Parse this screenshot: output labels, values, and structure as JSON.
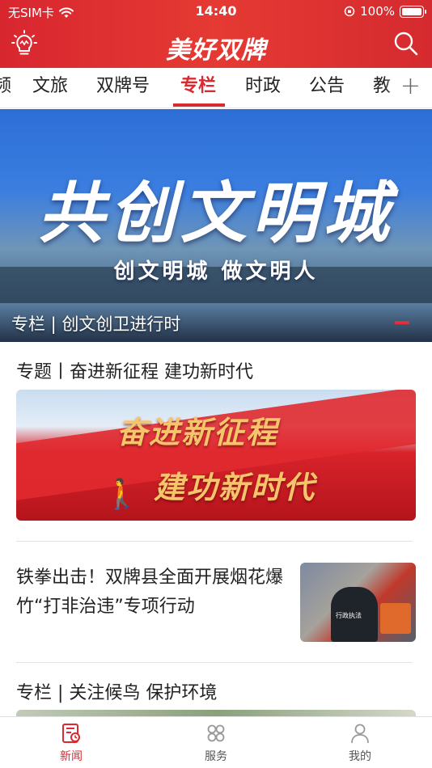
{
  "status_bar": {
    "carrier": "无SIM卡",
    "time": "14:40",
    "battery": "100%"
  },
  "header": {
    "title": "美好双牌",
    "left_icon": "lightbulb-icon",
    "right_icon": "search-icon"
  },
  "tabs": {
    "items": [
      "频",
      "文旅",
      "双牌号",
      "专栏",
      "时政",
      "公告",
      "教"
    ],
    "active": "专栏",
    "more_icon": "plus-icon"
  },
  "banner": {
    "title": "共创文明城",
    "subtitle": "创文明城 做文明人",
    "caption": "专栏 | 创文创卫进行时"
  },
  "feed": {
    "topic_section": {
      "title": "专题丨奋进新征程 建功新时代",
      "image_text_1": "奋进新征程",
      "image_text_2": "建功新时代"
    },
    "news_item": {
      "title": "铁拳出击！双牌县全面开展烟花爆竹“打非治违”专项行动",
      "thumb_label": "行政执法"
    },
    "column_section": {
      "title": "专栏 | 关注候鸟 保护环境"
    }
  },
  "bottom_nav": {
    "items": [
      {
        "label": "新闻",
        "icon": "news-icon",
        "active": true
      },
      {
        "label": "服务",
        "icon": "services-icon",
        "active": false
      },
      {
        "label": "我的",
        "icon": "profile-icon",
        "active": false
      }
    ]
  },
  "colors": {
    "brand_red": "#d82a2f",
    "text": "#222222"
  }
}
